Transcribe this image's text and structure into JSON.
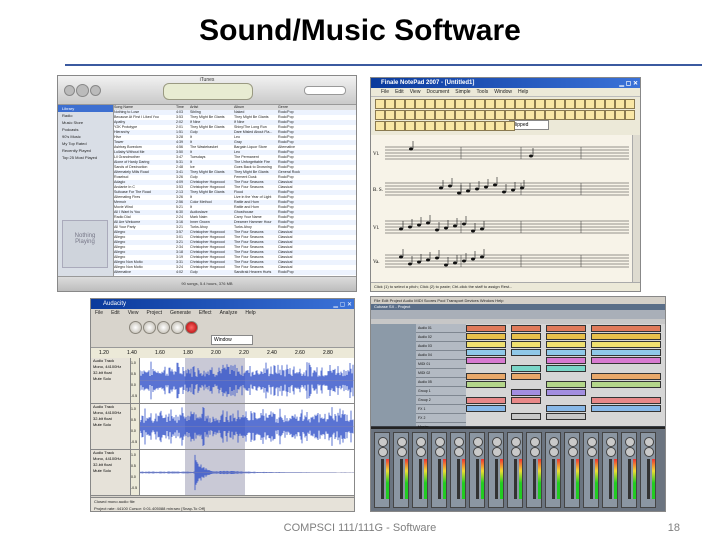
{
  "slide": {
    "title": "Sound/Music Software",
    "footer": "COMPSCI 111/111G - Software",
    "page_number": "18",
    "rule_color": "#3b5aa0"
  },
  "itunes": {
    "window_title": "iTunes",
    "lcd_glyph": "",
    "sources": [
      "Library",
      "Radio",
      "Music Store",
      "Podcasts",
      "90's Music",
      "My Top Rated",
      "Recently Played",
      "Top 25 Most Played"
    ],
    "artwork_placeholder": [
      "Nothing",
      "Playing"
    ],
    "columns": [
      "Song Name",
      "Time",
      "Artist",
      "Album",
      "Genre"
    ],
    "status": "90 songs, 5.4 hours, 376 MB",
    "rows": [
      [
        "Nothing to Lose",
        "4:03",
        "Sibling",
        "Naked",
        "Rock/Pop"
      ],
      [
        "Because At First I Liked You",
        "3:53",
        "They Might Be Giants",
        "They Might Be Giants",
        "Rock/Pop"
      ],
      [
        "Apathy",
        "2:02",
        "If Nine",
        "If Nine",
        "Rock/Pop"
      ],
      [
        "Y2K Prototype",
        "2:01",
        "They Might Be Giants",
        "Shiny/The Long Run",
        "Rock/Pop"
      ],
      [
        "Hierarchy",
        "1:51",
        "Gulp",
        "Dare Misled About Fla...",
        "Rock/Pop"
      ],
      [
        "Hive",
        "3:28",
        "It",
        "Leo",
        "Rock/Pop"
      ],
      [
        "Tower",
        "4:39",
        "It",
        "Gray",
        "Rock/Pop"
      ],
      [
        "Ashtray Boredom",
        "4:56",
        "The Wastebasket",
        "Bargain Liquor Store",
        "Alternative"
      ],
      [
        "Lullaby Without Me",
        "3:50",
        "It",
        "Leo",
        "Rock/Pop"
      ],
      [
        "Lil Grandmother",
        "3:47",
        "Tuesdays",
        "The Permanent",
        "Rock/Pop"
      ],
      [
        "Alone of Hardy Daring",
        "5:31",
        "It",
        "The Unforgettable Fire",
        "Rock/Pop"
      ],
      [
        "Sands of Destruction",
        "2:48",
        "Ice",
        "Goes Back to Drowning",
        "Rock/Pop"
      ],
      [
        "Alternately Mills Road",
        "3:41",
        "They Might Be Giants",
        "They Might Be Giants",
        "General Rock"
      ],
      [
        "Rosebud",
        "3:26",
        "Gulp",
        "Ferment Dusk",
        "Rock/Pop"
      ],
      [
        "Adagio",
        "4:09",
        "Christopher Hogwood",
        "The Four Seasons",
        "Classical"
      ],
      [
        "Andante In C",
        "3:53",
        "Christopher Hogwood",
        "The Four Seasons",
        "Classical"
      ],
      [
        "Suitcase For The Road",
        "2:13",
        "They Might Be Giants",
        "Flood",
        "Rock/Pop"
      ],
      [
        "Alternating Fires",
        "3:26",
        "It",
        "Live in the Year of Light",
        "Rock/Pop"
      ],
      [
        "Memoir",
        "2:56",
        "Color Method",
        "Rattle and Hum",
        "Rock/Pop"
      ],
      [
        "Movie Wind",
        "5:21",
        "It",
        "Rattle and Hum",
        "Rock/Pop"
      ],
      [
        "All I Want Is You",
        "6:30",
        "Audioslave",
        "Ghosthouse",
        "Rock/Pop"
      ],
      [
        "Radio Dial",
        "2:24",
        "Mark Naim",
        "Carry Your Name",
        "Rock/Pop"
      ],
      [
        "All Are Welcome",
        "3:16",
        "Inner Grown",
        "Dreamer Hammer Hour",
        "Rock/Pop"
      ],
      [
        "All Your Party",
        "3:21",
        "Turks Ahoy",
        "Turks Ahoy",
        "Rock/Pop"
      ],
      [
        "Allegro",
        "3:57",
        "Christopher Hogwood",
        "The Four Seasons",
        "Classical"
      ],
      [
        "Allegro",
        "3:01",
        "Christopher Hogwood",
        "The Four Seasons",
        "Classical"
      ],
      [
        "Allegro",
        "3:21",
        "Christopher Hogwood",
        "The Four Seasons",
        "Classical"
      ],
      [
        "Allegro",
        "2:34",
        "Christopher Hogwood",
        "The Four Seasons",
        "Classical"
      ],
      [
        "Allegro",
        "3:18",
        "Christopher Hogwood",
        "The Four Seasons",
        "Classical"
      ],
      [
        "Allegro",
        "3:19",
        "Christopher Hogwood",
        "The Four Seasons",
        "Classical"
      ],
      [
        "Allegro Non Molto",
        "3:31",
        "Christopher Hogwood",
        "The Four Seasons",
        "Classical"
      ],
      [
        "Allegro Non Molto",
        "3:24",
        "Christopher Hogwood",
        "The Four Seasons",
        "Classical"
      ],
      [
        "Alternative",
        "4:02",
        "Gulp",
        "Sandtrak Heaven Hurts",
        "Rock/Pop"
      ]
    ]
  },
  "finale": {
    "window_title": "Finale NotePad 2007 - [Untitled1]",
    "menu": [
      "File",
      "Edit",
      "View",
      "Document",
      "Simple",
      "Tools",
      "Window",
      "Help"
    ],
    "voice_field": "Flipped",
    "staff_labels": [
      "Vl.",
      "B. S.",
      "Vl.",
      "Va."
    ],
    "status": "Click (1) to select a pitch; Click (2) to paste; Ctrl-click the staff to assign Rest..."
  },
  "audacity": {
    "window_title": "Audacity",
    "menu": [
      "File",
      "Edit",
      "View",
      "Project",
      "Generate",
      "Effect",
      "Analyze",
      "Help"
    ],
    "selection_tool": "Window",
    "ruler_ticks": [
      "1.20",
      "1.40",
      "1.60",
      "1.80",
      "2.00",
      "2.20",
      "2.40",
      "2.60",
      "2.80"
    ],
    "tracks": [
      {
        "name": "Audio Track",
        "info": [
          "Mono, 44100Hz",
          "32-bit float",
          "Mute Solo"
        ]
      },
      {
        "name": "Audio Track",
        "info": [
          "Mono, 44100Hz",
          "32-bit float",
          "Mute Solo"
        ]
      },
      {
        "name": "Audio Track",
        "info": [
          "Mono, 44100Hz",
          "32-bit float",
          "Mute Solo"
        ]
      }
    ],
    "scale_ticks": [
      "1.0",
      "0.5",
      "0.0",
      "-0.5",
      "-1.0"
    ],
    "status_line1": "Closed mono audio file",
    "status_line2": "Project rate: 44100    Cursor: 0:01.405088 min:sec [Snap-To Off]"
  },
  "cubase": {
    "menu": [
      "File",
      "Edit",
      "Project",
      "Audio",
      "MIDI",
      "Scores",
      "Pool",
      "Transport",
      "Devices",
      "Window",
      "Help"
    ],
    "project_title": "Cubase SX - Project",
    "tracks": [
      "Audio 01",
      "Audio 02",
      "Audio 03",
      "Audio 04",
      "MIDI 01",
      "MIDI 02",
      "Audio 05",
      "Group 1",
      "Group 2",
      "FX 1",
      "FX 2",
      "Master"
    ],
    "mixer_channels": 15
  }
}
